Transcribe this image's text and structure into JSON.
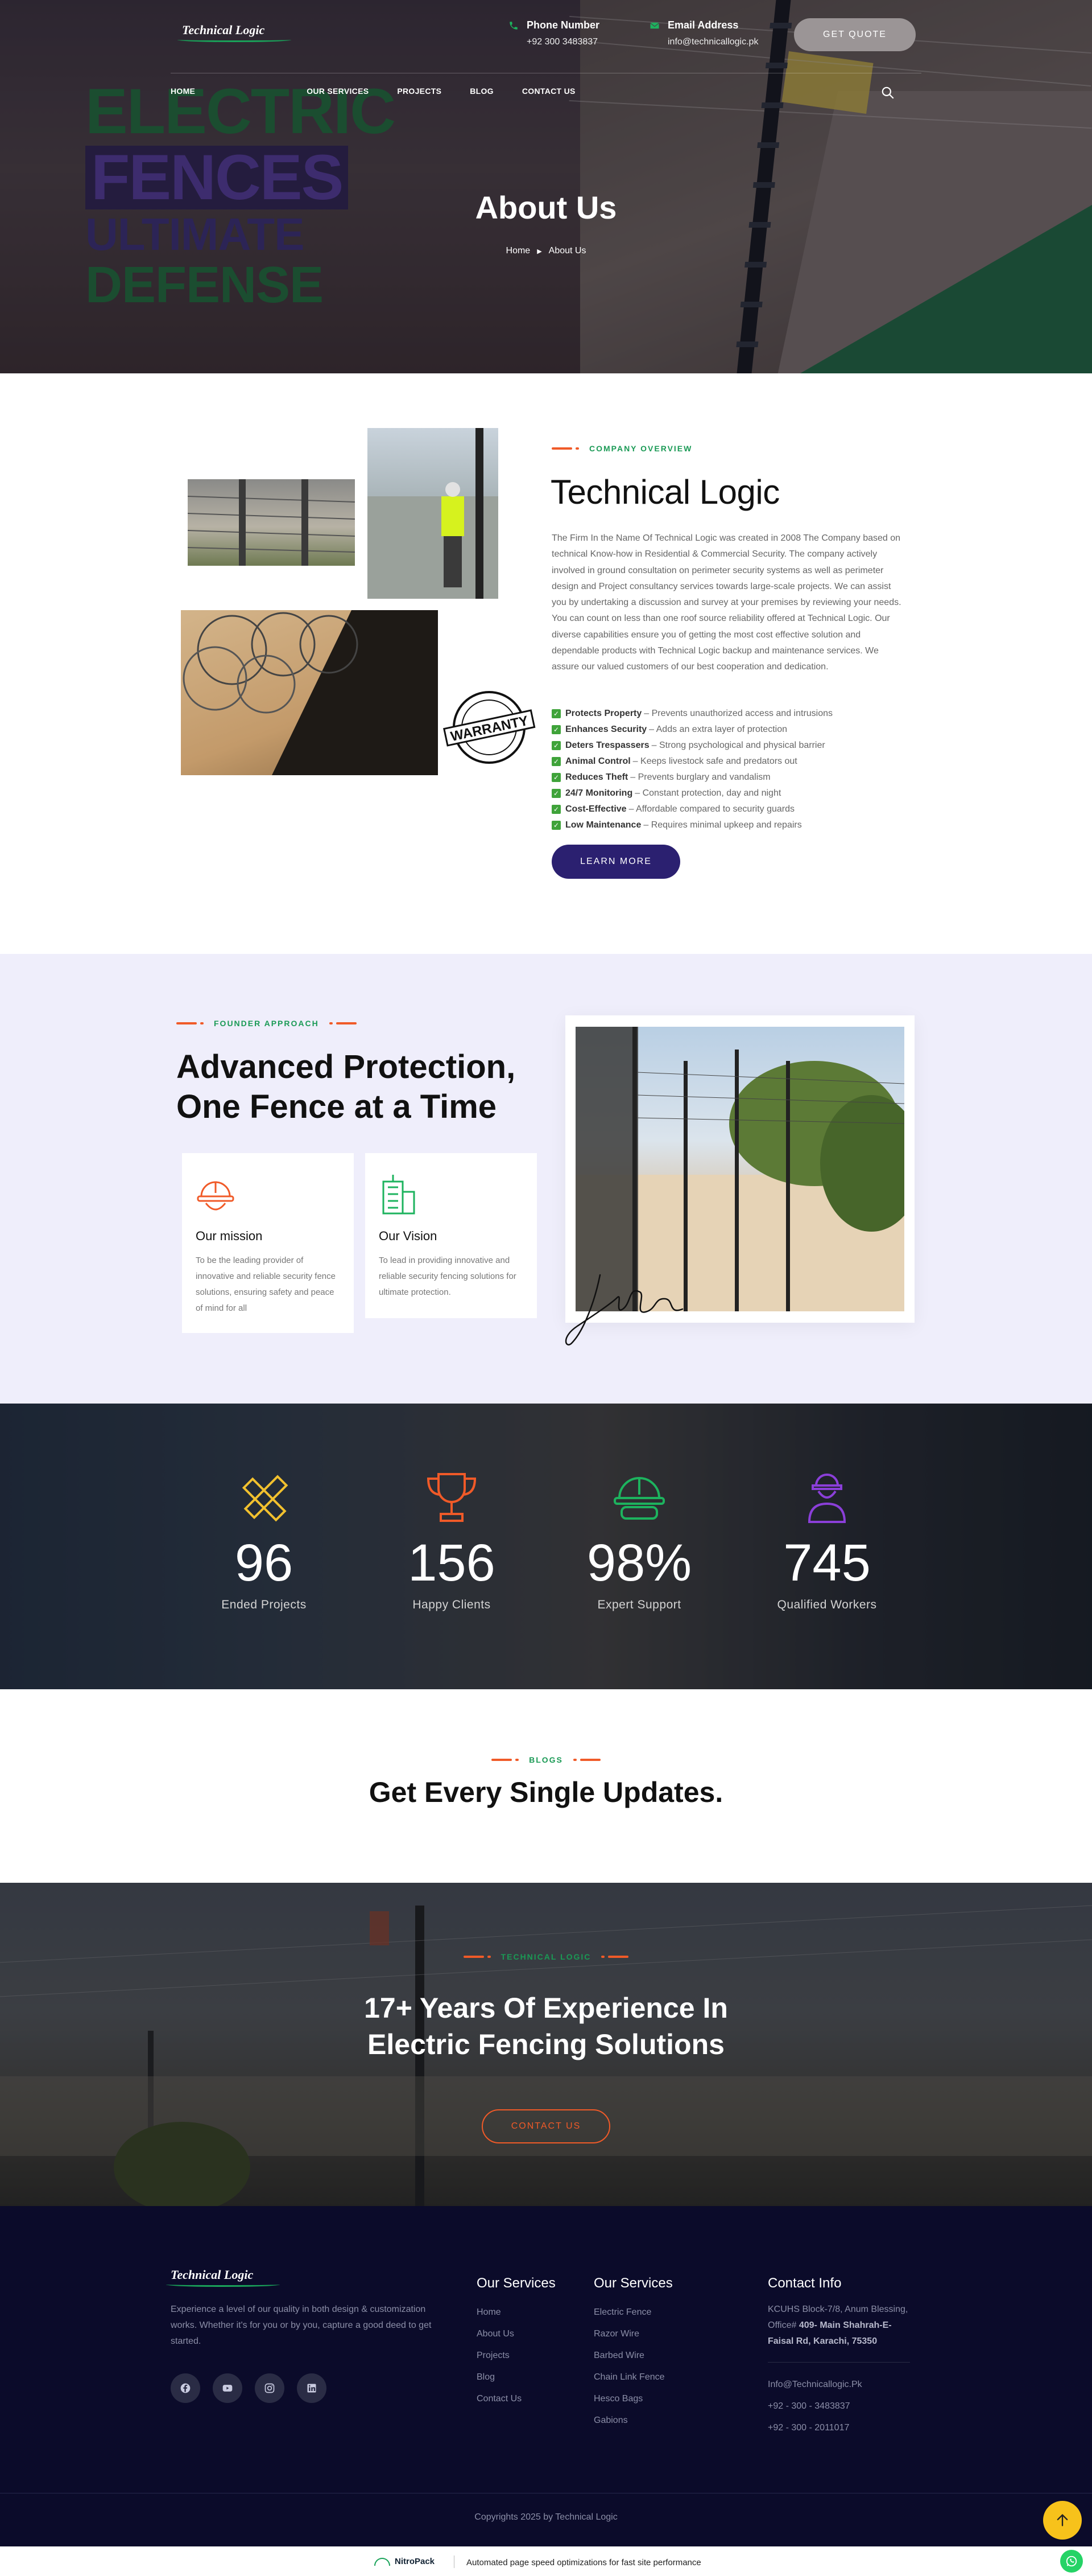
{
  "header": {
    "logo_text": "Technical Logic",
    "phone_label": "Phone Number",
    "phone_value": "+92 300 3483837",
    "email_label": "Email Address",
    "email_value": "info@technicallogic.pk",
    "quote_button": "GET QUOTE",
    "nav": [
      "HOME",
      "OUR SERVICES",
      "PROJECTS",
      "BLOG",
      "CONTACT US"
    ]
  },
  "hero": {
    "image_lines": [
      "ELECTRIC",
      "FENCES",
      "ULTIMATE",
      "DEFENSE"
    ],
    "title": "About Us",
    "breadcrumb_home": "Home",
    "breadcrumb_current": "About Us"
  },
  "about": {
    "eyebrow": "COMPANY OVERVIEW",
    "title": "Technical Logic",
    "paragraph": "The Firm In the Name Of Technical Logic was created in 2008 The Company based on technical Know-how in Residential & Commercial Security. The company actively involved in ground consultation on perimeter security systems as well as perimeter design and Project consultancy services towards large-scale projects. We can assist you by undertaking a discussion and survey at your premises by reviewing your needs. You can count on less than one roof source reliability offered at Technical Logic. Our diverse capabilities ensure you of getting the most cost effective solution and dependable products with Technical Logic backup and maintenance services. We assure our valued customers of our best cooperation and dedication.",
    "badge_text": "WARRANTY",
    "features": [
      {
        "title": "Protects Property",
        "desc": "– Prevents unauthorized access and intrusions"
      },
      {
        "title": "Enhances Security",
        "desc": "– Adds an extra layer of protection"
      },
      {
        "title": "Deters Trespassers",
        "desc": "– Strong psychological and physical barrier"
      },
      {
        "title": "Animal Control",
        "desc": "– Keeps livestock safe and predators out"
      },
      {
        "title": "Reduces Theft",
        "desc": "– Prevents burglary and vandalism"
      },
      {
        "title": "24/7 Monitoring",
        "desc": "– Constant protection, day and night"
      },
      {
        "title": "Cost-Effective",
        "desc": "– Affordable compared to security guards"
      },
      {
        "title": "Low Maintenance",
        "desc": "– Requires minimal upkeep and repairs"
      }
    ],
    "learn_button": "LEARN MORE"
  },
  "founder": {
    "eyebrow": "FOUNDER APPROACH",
    "title_line1": "Advanced Protection,",
    "title_line2": "One Fence at a Time",
    "mission_title": "Our mission",
    "mission_text": "To be the leading provider of innovative and reliable security fence solutions, ensuring safety and peace of mind for all",
    "vision_title": "Our Vision",
    "vision_text": "To lead in providing innovative and reliable security fencing solutions for ultimate protection."
  },
  "stats": [
    {
      "number": "96",
      "label": "Ended Projects",
      "icon": "ruler-pencil-icon",
      "color": "#f2c12e"
    },
    {
      "number": "156",
      "label": "Happy Clients",
      "icon": "trophy-icon",
      "color": "#f05a28"
    },
    {
      "number": "98%",
      "label": "Expert Support",
      "icon": "helmet-goggles-icon",
      "color": "#1db35e"
    },
    {
      "number": "745",
      "label": "Qualified Workers",
      "icon": "worker-icon",
      "color": "#8b3fd9"
    }
  ],
  "blogs": {
    "eyebrow": "BLOGS",
    "title": "Get Every Single Updates."
  },
  "cta": {
    "eyebrow": "TECHNICAL LOGIC",
    "title_line1": "17+ Years Of Experience In",
    "title_line2": "Electric Fencing Solutions",
    "button": "CONTACT US"
  },
  "footer": {
    "about": "Experience a level of our quality in both design & customization works. Whether it's for you or by you, capture a good deed to get started.",
    "col1_title": "Our Services",
    "col1_links": [
      "Home",
      "About Us",
      "Projects",
      "Blog",
      "Contact Us"
    ],
    "col2_title": "Our Services",
    "col2_links": [
      "Electric Fence",
      "Razor Wire",
      "Barbed Wire",
      "Chain Link Fence",
      "Hesco Bags",
      "Gabions"
    ],
    "col3_title": "Contact Info",
    "address_plain": "KCUHS Block-7/8, Anum Blessing, Office#",
    "address_bold": "409- Main Shahrah-E-Faisal Rd, Karachi, 75350",
    "email": "Info@Technicallogic.Pk",
    "phone1": "+92 - 300 - 3483837",
    "phone2": "+92 - 300 - 2011017",
    "copyright": "Copyrights 2025 by Technical Logic"
  },
  "nitropack": {
    "logo": "NitroPack",
    "text": "Automated page speed optimizations for fast site performance"
  },
  "colors": {
    "accent_orange": "#f05a28",
    "accent_green": "#1a9a55",
    "primary_indigo": "#2b2070",
    "footer_bg": "#0b0b2a"
  }
}
